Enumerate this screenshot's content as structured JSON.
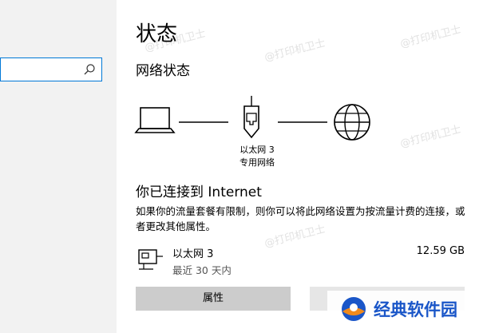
{
  "sidebar": {
    "search_placeholder": ""
  },
  "main": {
    "page_title": "状态",
    "section_title": "网络状态",
    "network_name": "以太网 3",
    "network_type": "专用网络",
    "connected_title": "你已连接到 Internet",
    "connected_desc": "如果你的流量套餐有限制，则你可以将此网络设置为按流量计费的连接，或者更改其他属性。",
    "adapter": {
      "name": "以太网 3",
      "sub": "最近 30 天内",
      "size": "12.59 GB"
    },
    "buttons": {
      "properties": "属性",
      "data_usage": ""
    }
  },
  "watermark": {
    "brand_text": "经典软件园",
    "faint_text": "@打印机卫士"
  },
  "icons": {
    "search": "search-icon",
    "computer": "laptop-icon",
    "ethernet": "ethernet-icon",
    "internet": "globe-icon",
    "adapter": "network-adapter-icon"
  }
}
